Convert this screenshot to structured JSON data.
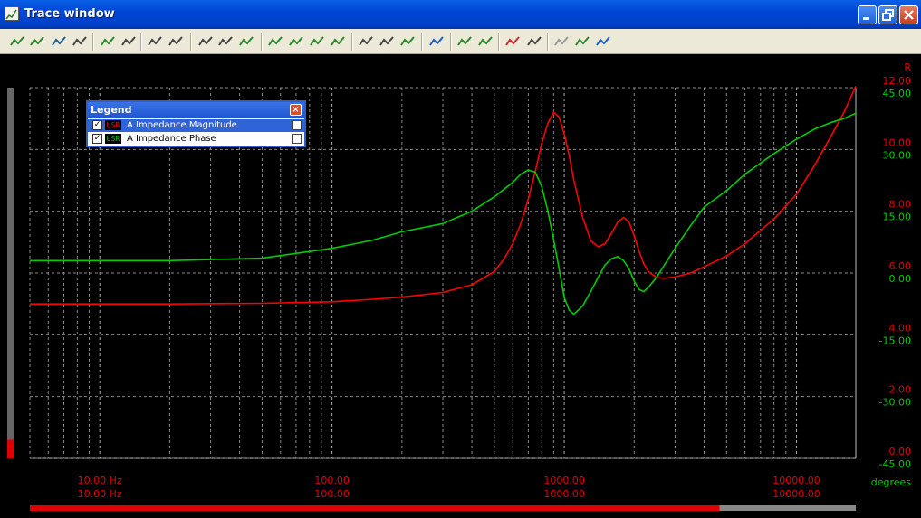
{
  "window": {
    "title": "Trace window"
  },
  "legend": {
    "title": "Legend",
    "items": [
      {
        "badge": "USR",
        "name": "A  Impedance Magnitude",
        "color": "#ff0000",
        "checked": true
      },
      {
        "badge": "USR",
        "name": "A  Impedance Phase",
        "color": "#00cc00",
        "checked": true
      }
    ]
  },
  "toolbar": {
    "icons": [
      "add-trace-icon",
      "add-curve-icon",
      "save-icon",
      "copy-icon",
      "color-scheme-icon",
      "print-icon",
      "grid-settings-icon",
      "cursor-readout-icon",
      "zoom-in-icon",
      "zoom-out-icon",
      "fit-curve-icon",
      "shift-left-icon",
      "shift-right-icon",
      "peak-up-icon",
      "peak-down-icon",
      "search-icon",
      "zoom-x-icon",
      "trace-curve-icon",
      "chart-settings-icon",
      "cursor-up-icon",
      "cursor-down-icon",
      "data-table-icon",
      "slider-move-icon",
      "reset-icon",
      "compare-icon",
      "markers-icon"
    ]
  },
  "axes": {
    "right_top_label": "R",
    "right_unit_label": "degrees",
    "left_scale": {
      "label": "R",
      "ticks": [
        "12.00",
        "10.00",
        "8.00",
        "6.00",
        "4.00",
        "2.00",
        "0.00"
      ]
    },
    "right_scale": {
      "label": "degrees",
      "ticks": [
        "45.00",
        "30.00",
        "15.00",
        "0.00",
        "-15.00",
        "-30.00",
        "-45.00"
      ]
    },
    "x_ticks_row1": [
      "10.00 Hz",
      "100.00",
      "1000.00",
      "10000.00"
    ],
    "x_ticks_row2": [
      "10.00 Hz",
      "100.00",
      "1000.00",
      "10000.00"
    ]
  },
  "scrollbar": {
    "fill_fraction": 0.835
  },
  "level_indicator": {
    "fill_fraction": 0.05
  },
  "chart_data": {
    "type": "line",
    "x_scale": "log",
    "xlim": [
      5.0,
      18000.0
    ],
    "y_magnitude_lim": [
      0,
      12
    ],
    "y_phase_lim": [
      -45,
      45
    ],
    "grid": true,
    "series": [
      {
        "name": "A  Impedance Magnitude",
        "axis": "magnitude",
        "color": "#ff0000",
        "x": [
          5,
          10,
          20,
          50,
          100,
          150,
          200,
          300,
          400,
          500,
          550,
          600,
          650,
          700,
          750,
          800,
          850,
          900,
          950,
          1000,
          1050,
          1100,
          1200,
          1300,
          1400,
          1500,
          1600,
          1700,
          1800,
          1900,
          2000,
          2100,
          2200,
          2300,
          2500,
          2700,
          3000,
          3500,
          4000,
          5000,
          6000,
          8000,
          10000,
          12000,
          14000,
          16000,
          18000
        ],
        "values": [
          5.0,
          5.0,
          5.0,
          5.02,
          5.07,
          5.15,
          5.22,
          5.37,
          5.62,
          6.05,
          6.45,
          6.95,
          7.6,
          8.4,
          9.3,
          10.2,
          10.85,
          11.2,
          11.05,
          10.5,
          9.8,
          9.0,
          7.8,
          7.05,
          6.85,
          6.95,
          7.3,
          7.65,
          7.8,
          7.65,
          7.2,
          6.7,
          6.3,
          6.05,
          5.85,
          5.83,
          5.87,
          6.0,
          6.2,
          6.55,
          6.95,
          7.75,
          8.55,
          9.5,
          10.4,
          11.2,
          12.05
        ]
      },
      {
        "name": "A  Impedance Phase",
        "axis": "phase",
        "color": "#00cc00",
        "x": [
          5,
          10,
          20,
          50,
          100,
          150,
          200,
          300,
          400,
          500,
          600,
          650,
          700,
          750,
          800,
          850,
          900,
          950,
          1000,
          1050,
          1100,
          1200,
          1300,
          1400,
          1500,
          1600,
          1700,
          1800,
          1900,
          2000,
          2100,
          2200,
          2300,
          2500,
          3000,
          3500,
          4000,
          5000,
          6000,
          8000,
          10000,
          12000,
          14000,
          16000,
          18000
        ],
        "values": [
          3.0,
          3.0,
          3.0,
          3.6,
          6.0,
          8.0,
          10.0,
          12.0,
          15.0,
          18.5,
          22.0,
          24.0,
          25.0,
          24.5,
          21.0,
          15.0,
          8.0,
          1.0,
          -6.0,
          -9.0,
          -10.0,
          -8.0,
          -4.5,
          -1.0,
          2.0,
          3.5,
          4.0,
          3.0,
          1.0,
          -2.0,
          -4.0,
          -4.5,
          -3.5,
          -1.0,
          6.0,
          11.5,
          16.0,
          20.0,
          24.0,
          29.0,
          32.5,
          35.0,
          36.5,
          37.5,
          38.8
        ]
      }
    ]
  }
}
